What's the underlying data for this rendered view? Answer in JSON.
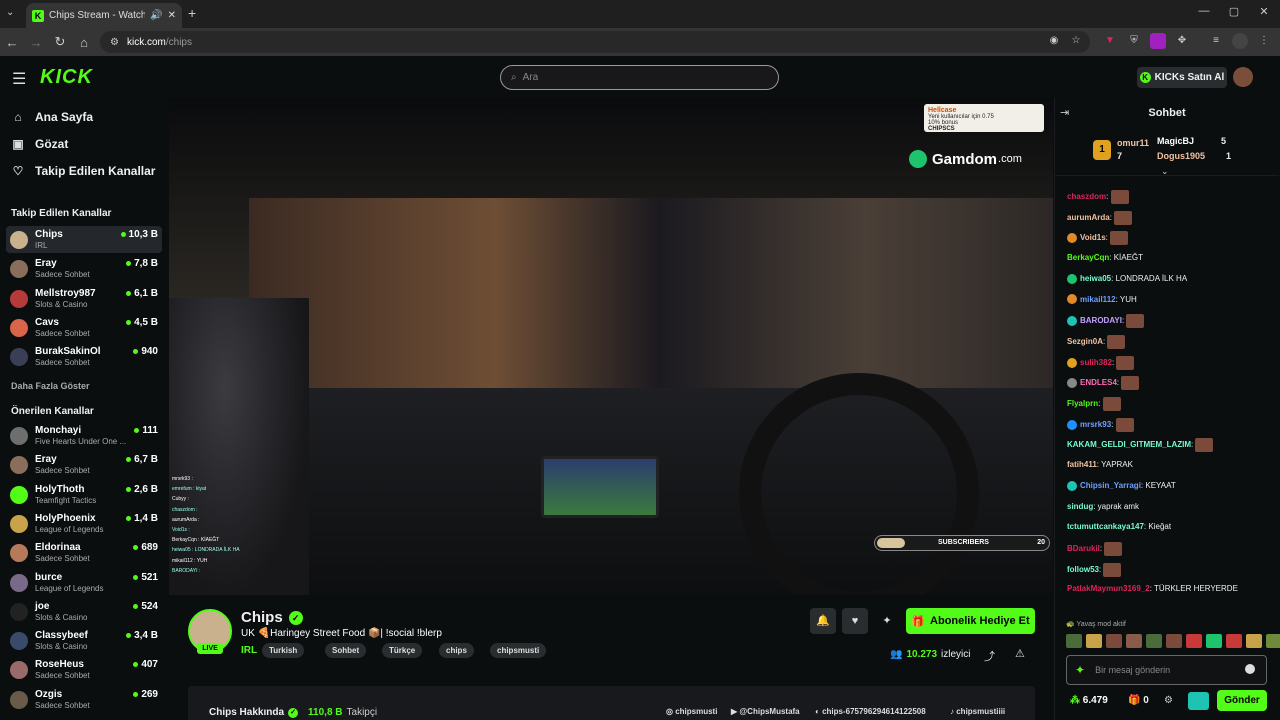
{
  "browser": {
    "tab_title": "Chips Stream - Watch Live o",
    "url_domain": "kick.com",
    "url_path": "/chips"
  },
  "header": {
    "logo": "KICK",
    "search_placeholder": "Ara",
    "kicks_button": "KICKs Satın Al"
  },
  "nav": {
    "home": "Ana Sayfa",
    "browse": "Gözat",
    "following": "Takip Edilen Kanallar"
  },
  "followed": {
    "heading": "Takip Edilen Kanallar",
    "show_more": "Daha Fazla Göster",
    "channels": [
      {
        "name": "Chips",
        "sub": "IRL",
        "viewers": "10,3 B",
        "color": "#c9b18e"
      },
      {
        "name": "Eray",
        "sub": "Sadece Sohbet",
        "viewers": "7,8 B",
        "color": "#8a6d5a"
      },
      {
        "name": "Mellstroy987",
        "sub": "Slots & Casino",
        "viewers": "6,1 B",
        "color": "#b53a3a"
      },
      {
        "name": "Cavs",
        "sub": "Sadece Sohbet",
        "viewers": "4,5 B",
        "color": "#d8644a"
      },
      {
        "name": "BurakSakinOl",
        "sub": "Sadece Sohbet",
        "viewers": "940",
        "color": "#3b3f55"
      }
    ]
  },
  "recommended": {
    "heading": "Önerilen Kanallar",
    "channels": [
      {
        "name": "Monchayi",
        "sub": "Five Hearts Under One ...",
        "viewers": "111",
        "color": "#6e6e6e"
      },
      {
        "name": "Eray",
        "sub": "Sadece Sohbet",
        "viewers": "6,7 B",
        "color": "#8a6d5a"
      },
      {
        "name": "HolyThoth",
        "sub": "Teamfight Tactics",
        "viewers": "2,6 B",
        "color": "#53fc18"
      },
      {
        "name": "HolyPhoenix",
        "sub": "League of Legends",
        "viewers": "1,4 B",
        "color": "#c8a34a"
      },
      {
        "name": "Eldorinaa",
        "sub": "Sadece Sohbet",
        "viewers": "689",
        "color": "#b57a5a"
      },
      {
        "name": "burce",
        "sub": "League of Legends",
        "viewers": "521",
        "color": "#7a6a8a"
      },
      {
        "name": "joe",
        "sub": "Slots & Casino",
        "viewers": "524",
        "color": "#222"
      },
      {
        "name": "Classybeef",
        "sub": "Slots & Casino",
        "viewers": "3,4 B",
        "color": "#3a4a6a"
      },
      {
        "name": "RoseHeus",
        "sub": "Sadece Sohbet",
        "viewers": "407",
        "color": "#9a6a6a"
      },
      {
        "name": "Ozgis",
        "sub": "Sadece Sohbet",
        "viewers": "269",
        "color": "#6a5a4a"
      }
    ]
  },
  "video": {
    "brand": "Gamdom",
    "brand_suffix": ".com",
    "promo_line1": "Hellcase",
    "promo_line2": "Yeni kullanıcılar için 0.75",
    "promo_line3": "10% bonus",
    "promo_code": "CHIPSCS",
    "subs_label": "SUBSCRIBERS",
    "subs_count": "20",
    "subs_goal_fraction": 0.16,
    "overlay_chat": [
      "mrsrk93 :",
      "emrefum : kiyat",
      "Cubyy :",
      "chaszdom :",
      "aurumArda :",
      "Void1s :",
      "BerkayCqn : KİAEĞT",
      "heiwa05 : LONDRADA İLK HA",
      "mikail112 : YUH",
      "BARODAYI :"
    ]
  },
  "stream": {
    "name": "Chips",
    "title": "UK 🍕Haringey Street Food 📦| !social !blerp",
    "category": "IRL",
    "live": "LIVE",
    "tags": [
      "Turkish",
      "Sohbet",
      "Türkçe",
      "chips",
      "chipsmusti"
    ],
    "gift_button": "Abonelik Hediye Et",
    "viewers": "10.273",
    "viewers_label": "izleyici"
  },
  "about": {
    "title": "Chips Hakkında",
    "followers": "110,8 B",
    "followers_label": "Takipçi",
    "socials": [
      "chipsmusti",
      "@ChipsMustafa",
      "chips-675796294614122508",
      "chipsmustiiii"
    ]
  },
  "chat": {
    "title": "Sohbet",
    "leaders": [
      {
        "name": "omur11",
        "count": "7"
      },
      {
        "name": "MagicBJ",
        "count": "5"
      },
      {
        "name": "Dogus1905",
        "count": "1"
      }
    ],
    "messages": [
      {
        "user": "chaszdom",
        "color": "#e0245e",
        "text": "",
        "emote": true
      },
      {
        "user": "aurumArda",
        "color": "#f2c2a2",
        "text": "",
        "emote": true
      },
      {
        "user": "Void1s",
        "color": "#f2c2a2",
        "text": "",
        "emote": true,
        "badge": "#e08a2a"
      },
      {
        "user": "BerkayCqn",
        "color": "#53fc18",
        "text": "KİAEĞT"
      },
      {
        "user": "heiwa05",
        "color": "#75fdd1",
        "text": "LONDRADA İLK HA",
        "badge": "#1ec36e"
      },
      {
        "user": "mikail112",
        "color": "#6ea0ff",
        "text": "YUH",
        "badge": "#e08a2a"
      },
      {
        "user": "BARODAYI",
        "color": "#c3a0ff",
        "text": "",
        "emote": true,
        "badge": "#1ec3b4"
      },
      {
        "user": "Sezgin0A",
        "color": "#f2c2a2",
        "text": "",
        "emote": true
      },
      {
        "user": "sulih382",
        "color": "#e0245e",
        "text": "",
        "emote": true,
        "badge": "#e0a020"
      },
      {
        "user": "ENDLES4",
        "color": "#ff6bb5",
        "text": "",
        "emote": true,
        "badge": "#888"
      },
      {
        "user": "Flyalprn",
        "color": "#53fc18",
        "text": "",
        "emote": true
      },
      {
        "user": "mrsrk93",
        "color": "#6ea0ff",
        "text": "",
        "emote": true,
        "badge": "#1e90ff"
      },
      {
        "user": "KAKAM_GELDI_GITMEM_LAZIM",
        "color": "#75fdd1",
        "text": "",
        "emote": true
      },
      {
        "user": "fatih411",
        "color": "#f2c2a2",
        "text": "YAPRAK"
      },
      {
        "user": "Chipsin_Yarragi",
        "color": "#6ea0ff",
        "text": "KEYAAT",
        "badge": "#1ec3b4"
      },
      {
        "user": "sindug",
        "color": "#75fdd1",
        "text": "yaprak amk"
      },
      {
        "user": "tctumuttcankaya147",
        "color": "#75fdd1",
        "text": "Kieğat"
      },
      {
        "user": "BDarukil",
        "color": "#e0245e",
        "text": "",
        "emote": true
      },
      {
        "user": "follow53",
        "color": "#75fdd1",
        "text": "",
        "emote": true
      },
      {
        "user": "PatlakMaymun3169_2",
        "color": "#e0245e",
        "text": "TÜRKLER HERYERDE"
      }
    ],
    "slow_mode": "Yavaş mod aktif",
    "input_placeholder": "Bir mesaj gönderin",
    "kicks_balance": "6.479",
    "gift_count": "0",
    "send": "Gönder"
  }
}
